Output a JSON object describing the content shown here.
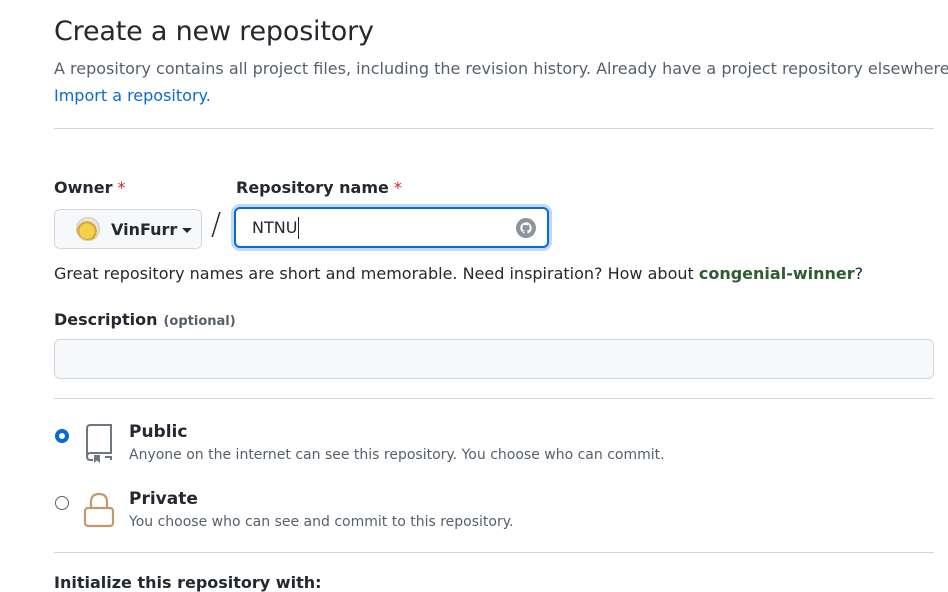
{
  "header": {
    "title": "Create a new repository",
    "subtitle": "A repository contains all project files, including the revision history. Already have a project repository elsewhere?",
    "import_link": "Import a repository."
  },
  "form": {
    "owner_label": "Owner",
    "required_mark": "*",
    "owner_value": "VinFurr",
    "separator": "/",
    "repo_name_label": "Repository name",
    "repo_name_value": "NTNU",
    "hint_prefix": "Great repository names are short and memorable. Need inspiration? How about ",
    "hint_suggestion": "congenial-winner",
    "hint_suffix": "?",
    "description_label": "Description",
    "description_optional": "(optional)",
    "description_value": ""
  },
  "visibility": {
    "options": [
      {
        "title": "Public",
        "description": "Anyone on the internet can see this repository. You choose who can commit.",
        "selected": true,
        "icon": "repo-icon"
      },
      {
        "title": "Private",
        "description": "You choose who can see and commit to this repository.",
        "selected": false,
        "icon": "lock-icon"
      }
    ]
  },
  "initialize": {
    "label": "Initialize this repository with:"
  },
  "colors": {
    "accent": "#0969da",
    "required": "#cf222e",
    "suggestion": "#2f5c32",
    "muted": "#57606a",
    "border": "#d0d7de"
  }
}
